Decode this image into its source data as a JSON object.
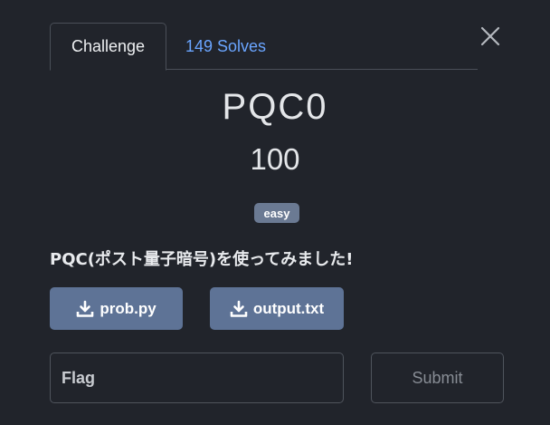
{
  "tabs": [
    {
      "label": "Challenge"
    },
    {
      "label": "149 Solves"
    }
  ],
  "challenge": {
    "title": "PQC0",
    "points": "100",
    "difficulty": "easy",
    "description": "PQC(ポスト量子暗号)を使ってみました!"
  },
  "files": [
    {
      "label": "prob.py",
      "icon": "download-icon"
    },
    {
      "label": "output.txt",
      "icon": "download-icon"
    }
  ],
  "form": {
    "flag_placeholder": "Flag",
    "flag_value": "",
    "submit_label": "Submit"
  },
  "colors": {
    "background": "#21242b",
    "link": "#6aa5ff",
    "file_button": "#5e7396",
    "badge": "#6b7a93"
  }
}
